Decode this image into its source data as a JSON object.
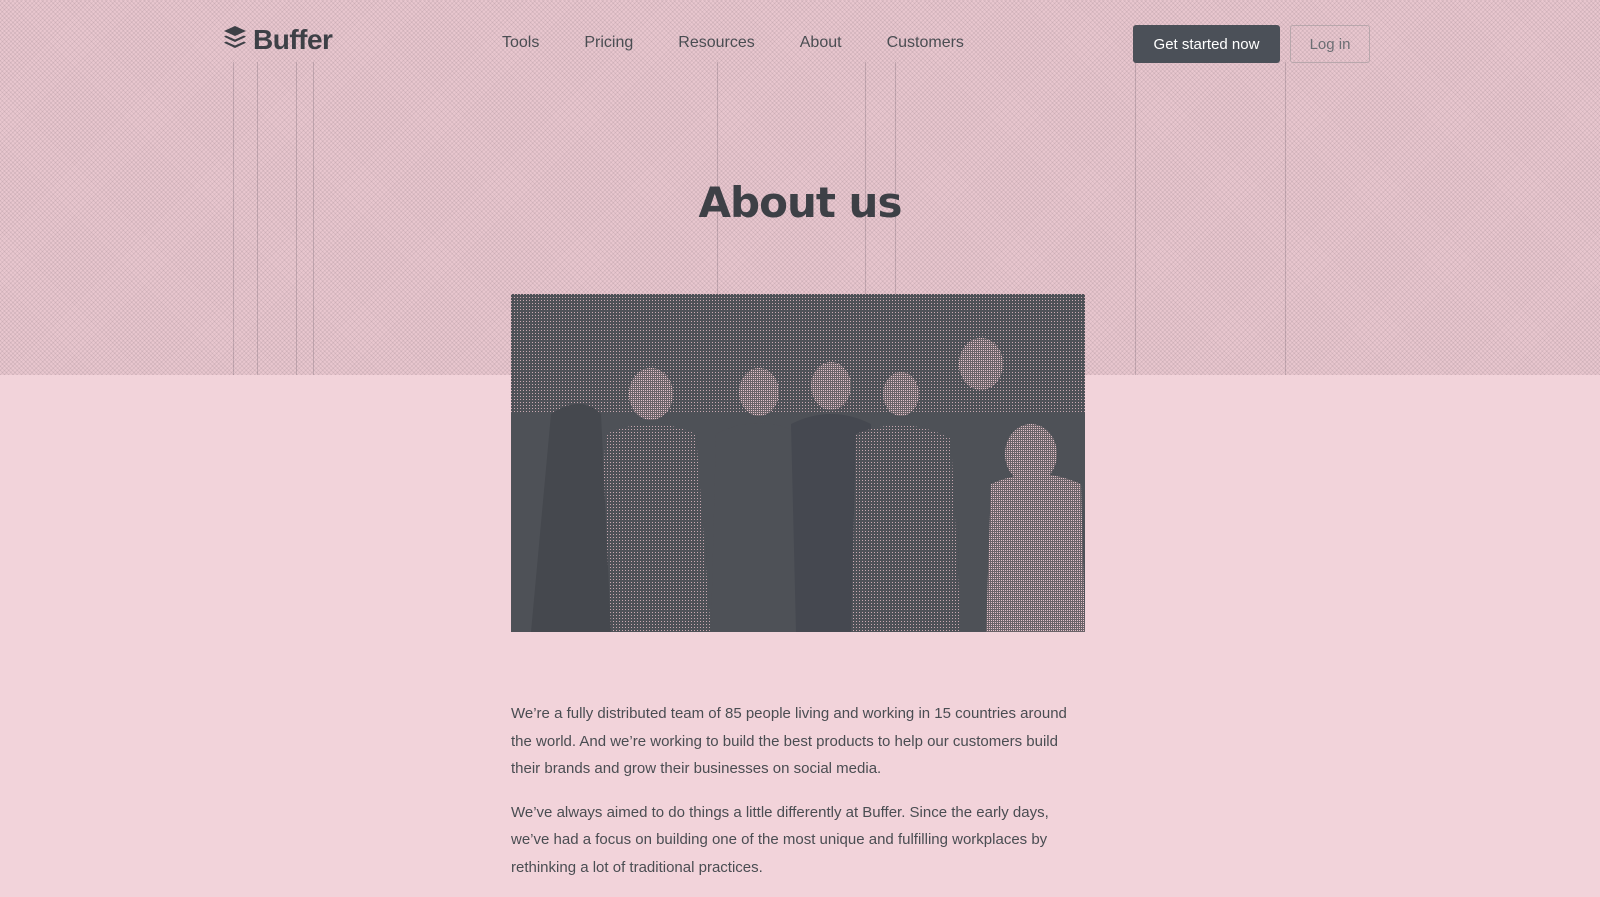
{
  "header": {
    "logo_text": "Buffer",
    "nav": [
      "Tools",
      "Pricing",
      "Resources",
      "About",
      "Customers"
    ],
    "cta_label": "Get started now",
    "login_label": "Log in"
  },
  "page_title": "About us",
  "body_paragraphs": [
    "We’re a fully distributed team of 85 people living and working in 15 countries around the world. And we’re working to build the best products to help our customers build their brands and grow their businesses on social media.",
    "We’ve always aimed to do things a little differently at Buffer. Since the early days, we’ve had a focus on building one of the most unique and fulfilling workplaces by rethinking a lot of traditional practices."
  ],
  "colors": {
    "background": "#f2d3da",
    "hero": "#e9c7cf",
    "text": "#4a4d52",
    "button": "#4b5058"
  },
  "icons": {
    "logo": "buffer-stack-icon"
  }
}
